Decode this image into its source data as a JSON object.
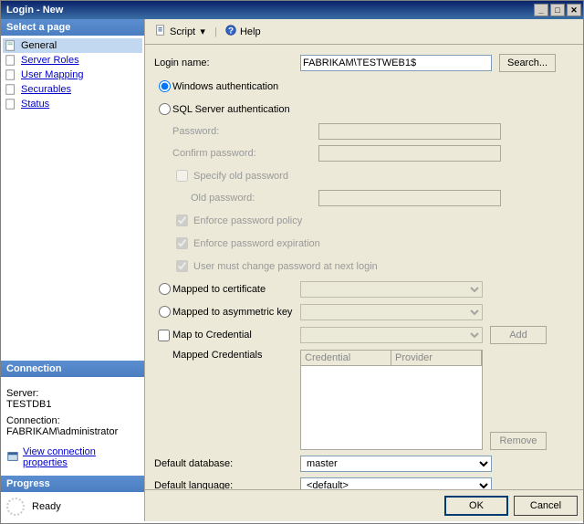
{
  "window": {
    "title": "Login - New"
  },
  "toolbar": {
    "script": "Script",
    "help": "Help"
  },
  "sidebar": {
    "select_page": "Select a page",
    "items": [
      {
        "label": "General"
      },
      {
        "label": "Server Roles"
      },
      {
        "label": "User Mapping"
      },
      {
        "label": "Securables"
      },
      {
        "label": "Status"
      }
    ],
    "connection_header": "Connection",
    "server_label": "Server:",
    "server_value": "TESTDB1",
    "connection_label": "Connection:",
    "connection_value": "FABRIKAM\\administrator",
    "view_props": "View connection properties",
    "progress_header": "Progress",
    "progress_status": "Ready"
  },
  "form": {
    "login_name_label": "Login name:",
    "login_name_value": "FABRIKAM\\TESTWEB1$",
    "search_btn": "Search...",
    "windows_auth": "Windows authentication",
    "sql_auth": "SQL Server authentication",
    "password": "Password:",
    "confirm_password": "Confirm password:",
    "specify_old": "Specify old password",
    "old_password": "Old password:",
    "enforce_policy": "Enforce password policy",
    "enforce_expiration": "Enforce password expiration",
    "must_change": "User must change password at next login",
    "mapped_cert": "Mapped to certificate",
    "mapped_asym": "Mapped to asymmetric key",
    "map_cred": "Map to Credential",
    "add_btn": "Add",
    "mapped_creds_label": "Mapped Credentials",
    "col_credential": "Credential",
    "col_provider": "Provider",
    "remove_btn": "Remove",
    "default_db_label": "Default database:",
    "default_db_value": "master",
    "default_lang_label": "Default language:",
    "default_lang_value": "<default>"
  },
  "footer": {
    "ok": "OK",
    "cancel": "Cancel"
  }
}
